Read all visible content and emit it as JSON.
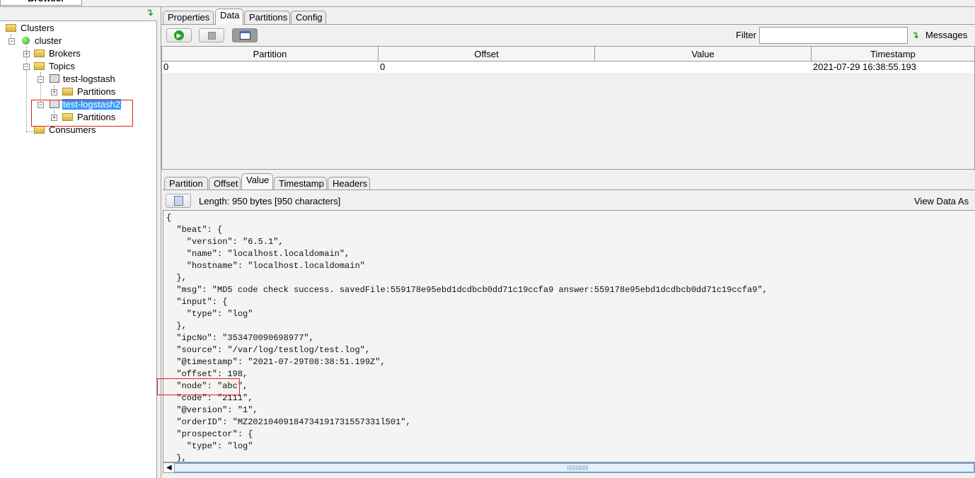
{
  "window": {
    "browser_tab": "Browser"
  },
  "tree": {
    "root": "Clusters",
    "cluster": "cluster",
    "brokers": "Brokers",
    "topics": "Topics",
    "topic1": "test-logstash",
    "topic1_partitions": "Partitions",
    "topic2": "test-logstash2",
    "topic2_partitions": "Partitions",
    "consumers": "Consumers"
  },
  "main_tabs": [
    {
      "label": "Properties"
    },
    {
      "label": "Data"
    },
    {
      "label": "Partitions"
    },
    {
      "label": "Config"
    }
  ],
  "active_main_tab": "Data",
  "toolbar": {
    "filter_label": "Filter",
    "filter_value": "",
    "messages_label": "Messages"
  },
  "table": {
    "columns": [
      "Partition",
      "Offset",
      "Value",
      "Timestamp"
    ],
    "rows": [
      [
        "0",
        "0",
        "{\"beat\":{\"version\":\"6.5.1\",\"name\":\"localhost.localdomai...",
        "2021-07-29 16:38:55.193"
      ]
    ]
  },
  "detail_tabs": [
    {
      "label": "Partition"
    },
    {
      "label": "Offset"
    },
    {
      "label": "Value"
    },
    {
      "label": "Timestamp"
    },
    {
      "label": "Headers"
    }
  ],
  "active_detail_tab": "Value",
  "detail": {
    "length_text": "Length: 950 bytes [950 characters]",
    "view_as": "View Data As"
  },
  "code_lines": [
    "{",
    "  \"beat\": {",
    "    \"version\": \"6.5.1\",",
    "    \"name\": \"localhost.localdomain\",",
    "    \"hostname\": \"localhost.localdomain\"",
    "  },",
    "  \"msg\": \"MD5 code check success. savedFile:559178e95ebd1dcdbcb0dd71c19ccfa9 answer:559178e95ebd1dcdbcb0dd71c19ccfa9\",",
    "  \"input\": {",
    "    \"type\": \"log\"",
    "  },",
    "  \"ipcNo\": \"353470090698977\",",
    "  \"source\": \"/var/log/testlog/test.log\",",
    "  \"@timestamp\": \"2021-07-29T08:38:51.199Z\",",
    "  \"offset\": 198,",
    "  \"node\": \"abc\",",
    "  \"code\": \"2111\",",
    "  \"@version\": \"1\",",
    "  \"orderID\": \"MZ20210409184734191731557331l501\",",
    "  \"prospector\": {",
    "    \"type\": \"log\"",
    "  },"
  ],
  "colors": {
    "selection": "#3399ff",
    "highlight_box": "#e02020"
  }
}
